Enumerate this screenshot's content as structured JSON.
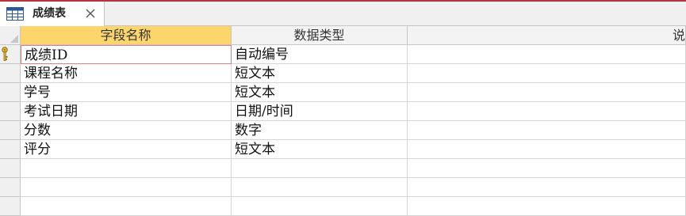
{
  "window": {
    "tab_title": "成绩表",
    "tab_icon": "table-icon",
    "close_icon": "close-icon"
  },
  "grid": {
    "columns": [
      "字段名称",
      "数据类型",
      "说"
    ],
    "rows": [
      {
        "field_name": "成绩ID",
        "data_type": "自动编号",
        "description": "",
        "is_primary_key": true
      },
      {
        "field_name": "课程名称",
        "data_type": "短文本",
        "description": ""
      },
      {
        "field_name": "学号",
        "data_type": "短文本",
        "description": ""
      },
      {
        "field_name": "考试日期",
        "data_type": "日期/时间",
        "description": ""
      },
      {
        "field_name": "分数",
        "data_type": "数字",
        "description": ""
      },
      {
        "field_name": "评分",
        "data_type": "短文本",
        "description": ""
      },
      {
        "field_name": "",
        "data_type": "",
        "description": ""
      },
      {
        "field_name": "",
        "data_type": "",
        "description": ""
      },
      {
        "field_name": "",
        "data_type": "",
        "description": ""
      }
    ]
  },
  "colors": {
    "accent_red": "#b5353a",
    "active_header": "#fcd66d",
    "grid_line": "#c6c6c6"
  }
}
